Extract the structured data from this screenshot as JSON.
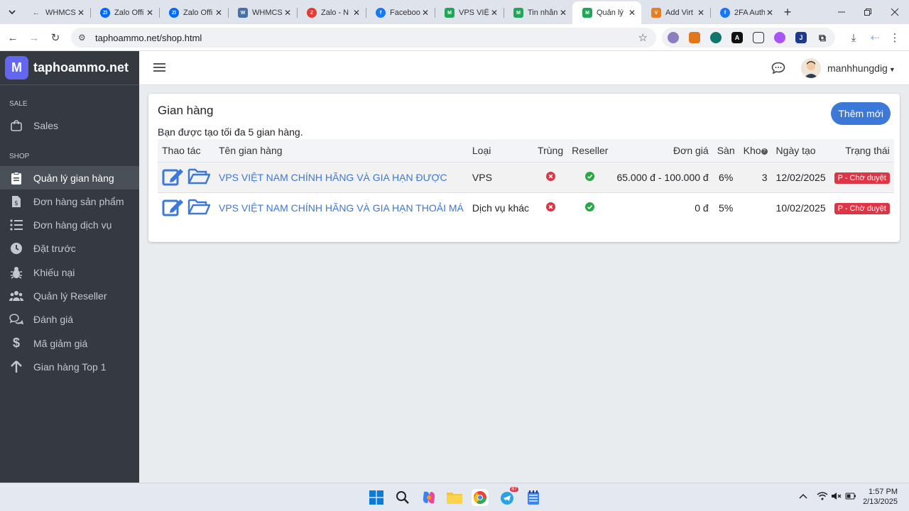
{
  "browser": {
    "tabs": [
      {
        "title": "WHMCS",
        "favicon_color": "#5f6368",
        "active": false
      },
      {
        "title": "Zalo Offi",
        "favicon_color": "#0068ff",
        "active": false
      },
      {
        "title": "Zalo Offi",
        "favicon_color": "#0068ff",
        "active": false
      },
      {
        "title": "WHMCS",
        "favicon_color": "#4a6fa5",
        "active": false
      },
      {
        "title": "Zalo - N",
        "favicon_color": "#e53935",
        "active": false
      },
      {
        "title": "Faceboo",
        "favicon_color": "#1877f2",
        "active": false
      },
      {
        "title": "VPS VIỆT",
        "favicon_color": "#22a559",
        "active": false
      },
      {
        "title": "Tin nhắn",
        "favicon_color": "#22a559",
        "active": false
      },
      {
        "title": "Quản lý",
        "favicon_color": "#22a559",
        "active": true
      },
      {
        "title": "Add Virt",
        "favicon_color": "#e67e22",
        "active": false
      },
      {
        "title": "2FA Auth",
        "favicon_color": "#1877f2",
        "active": false
      }
    ],
    "url": "taphoammo.net/shop.html"
  },
  "sidebar": {
    "brand_letter": "M",
    "brand_name": "taphoammo.net",
    "sections": {
      "sale": "SALE",
      "shop": "SHOP"
    },
    "items": [
      {
        "label": "Sales",
        "icon": "shopping-bag-icon"
      },
      {
        "label": "Quản lý gian hàng",
        "icon": "clipboard-icon",
        "active": true
      },
      {
        "label": "Đơn hàng sản phẩm",
        "icon": "file-dollar-icon"
      },
      {
        "label": "Đơn hàng dịch vụ",
        "icon": "list-icon"
      },
      {
        "label": "Đặt trước",
        "icon": "clock-icon"
      },
      {
        "label": "Khiếu nại",
        "icon": "bug-icon"
      },
      {
        "label": "Quản lý Reseller",
        "icon": "users-icon"
      },
      {
        "label": "Đánh giá",
        "icon": "comments-icon"
      },
      {
        "label": "Mã giảm giá",
        "icon": "dollar-icon"
      },
      {
        "label": "Gian hàng Top 1",
        "icon": "arrow-up-icon"
      }
    ]
  },
  "topnav": {
    "username": "manhhungdig"
  },
  "page": {
    "title": "Gian hàng",
    "subtitle": "Bạn được tạo tối đa 5 gian hàng.",
    "add_button": "Thêm mới",
    "table": {
      "headers": [
        "Thao tác",
        "Tên gian hàng",
        "Loại",
        "Trùng",
        "Reseller",
        "Đơn giá",
        "Sàn",
        "Kho",
        "Ngày tạo",
        "Trạng thái"
      ],
      "rows": [
        {
          "name": "VPS VIỆT NAM CHÍNH HÃNG VÀ GIA HẠN ĐƯỢC",
          "type": "VPS",
          "duplicate": "no",
          "reseller": "yes",
          "price": "65.000 đ - 100.000 đ",
          "fee": "6%",
          "stock": "3",
          "created": "12/02/2025",
          "status": "P - Chờ duyệt"
        },
        {
          "name": "VPS VIỆT NAM CHÍNH HÃNG VÀ GIA HẠN THOẢI MÁ",
          "type": "Dịch vụ khác",
          "duplicate": "no",
          "reseller": "yes",
          "price": "0 đ",
          "fee": "5%",
          "stock": "",
          "created": "10/02/2025",
          "status": "P - Chờ duyệt"
        }
      ]
    }
  },
  "taskbar": {
    "time": "1:57 PM",
    "date": "2/13/2025",
    "telegram_badge": "87"
  },
  "colors": {
    "sidebar_bg": "#343a40",
    "primary": "#3c78d8",
    "danger": "#dc3545",
    "success": "#28a745"
  }
}
